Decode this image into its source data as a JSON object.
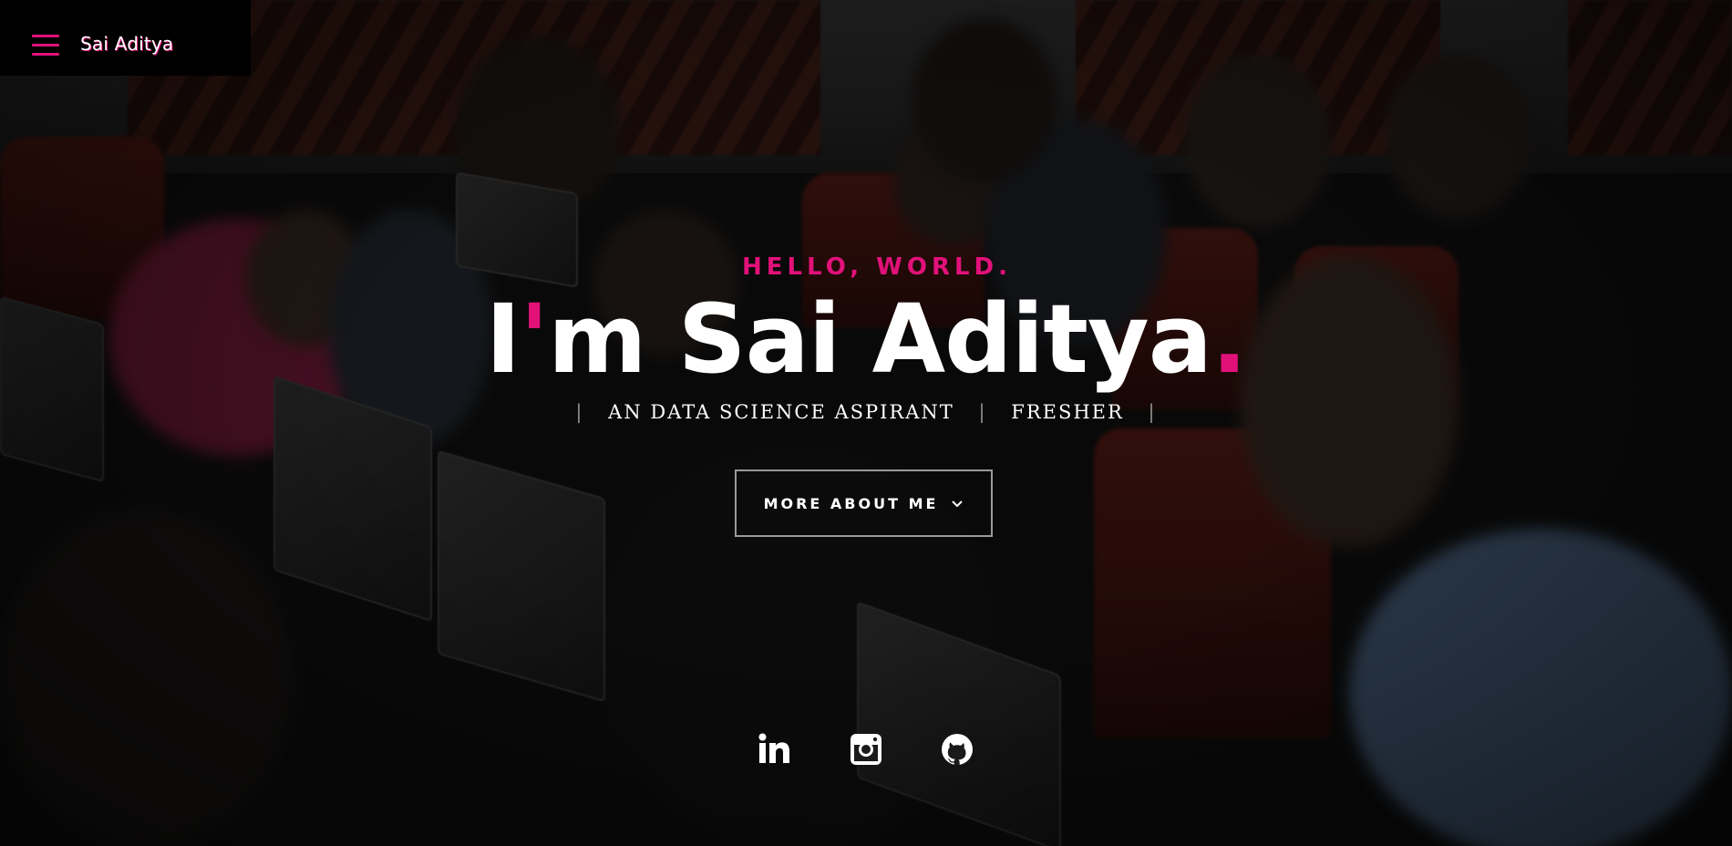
{
  "header": {
    "brand": "Sai Aditya",
    "menu_icon": "hamburger-menu-icon"
  },
  "hero": {
    "greeting": "HELLO, WORLD.",
    "title_prefix": "I",
    "title_apostrophe": "'",
    "title_rest": "m Sai Aditya",
    "title_dot": ".",
    "roles": [
      "AN DATA SCIENCE ASPIRANT",
      "FRESHER"
    ],
    "button_label": "MORE ABOUT ME",
    "button_icon": "chevron-down-icon"
  },
  "socials": [
    {
      "name": "linkedin",
      "icon": "linkedin-icon"
    },
    {
      "name": "instagram",
      "icon": "instagram-icon"
    },
    {
      "name": "github",
      "icon": "github-icon"
    }
  ],
  "colors": {
    "accent": "#e2117a",
    "text": "#ffffff",
    "header_bg": "#000000"
  }
}
